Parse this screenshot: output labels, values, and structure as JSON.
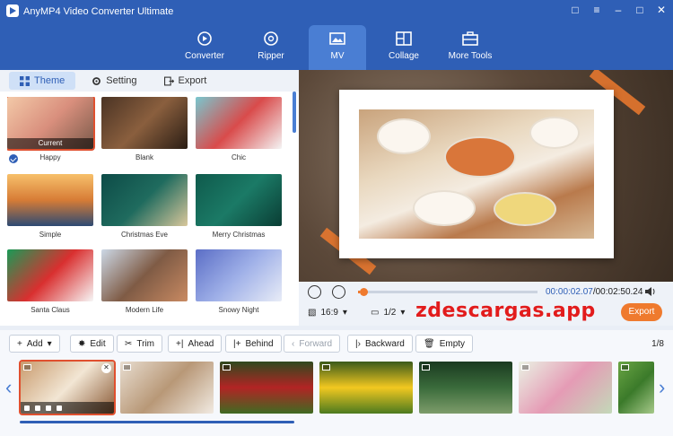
{
  "app": {
    "title": "AnyMP4 Video Converter Ultimate"
  },
  "nav": [
    {
      "label": "Converter",
      "icon": "converter-icon"
    },
    {
      "label": "Ripper",
      "icon": "disc-icon"
    },
    {
      "label": "MV",
      "icon": "mv-icon",
      "active": true
    },
    {
      "label": "Collage",
      "icon": "collage-icon"
    },
    {
      "label": "More Tools",
      "icon": "toolbox-icon"
    }
  ],
  "left_tabs": [
    {
      "label": "Theme",
      "icon": "grid-icon",
      "active": true
    },
    {
      "label": "Setting",
      "icon": "gear-icon"
    },
    {
      "label": "Export",
      "icon": "export-icon"
    }
  ],
  "themes": [
    {
      "name": "Happy",
      "tag": "Current",
      "selected": true,
      "bg": "linear-gradient(135deg,#f3c9a8,#d98f7d,#7a5a4a)"
    },
    {
      "name": "Blank",
      "bg": "linear-gradient(135deg,#4a3324,#8a5f3e,#2a1d14)"
    },
    {
      "name": "Chic",
      "bg": "linear-gradient(135deg,#79c7cf,#d94b4b,#f4f4f4)"
    },
    {
      "name": "Simple",
      "bg": "linear-gradient(180deg,#f7c06b,#d77c36,#2d4a73)"
    },
    {
      "name": "Christmas Eve",
      "bg": "linear-gradient(135deg,#0d4b47,#1f6b5e,#d9c79b)"
    },
    {
      "name": "Merry Christmas",
      "bg": "linear-gradient(135deg,#0f5a4c,#1b7a66,#0a3d34)"
    },
    {
      "name": "Santa Claus",
      "bg": "linear-gradient(135deg,#1a9a56,#d92f2f,#f7f7f7)"
    },
    {
      "name": "Modern Life",
      "bg": "linear-gradient(135deg,#ccd8e6,#7f5b45,#c98a62)"
    },
    {
      "name": "Snowy Night",
      "bg": "linear-gradient(135deg,#5b6ec6,#9fb0e8,#e8ecf7)"
    }
  ],
  "player": {
    "current_time": "00:00:02.07",
    "total_time": "/00:02:50.24",
    "progress": 0.01,
    "ratio": "16:9",
    "page": "1/2",
    "export_label": "Export",
    "watermark": "zdescargas.app"
  },
  "toolbar": {
    "add": "Add",
    "edit": "Edit",
    "trim": "Trim",
    "ahead": "Ahead",
    "behind": "Behind",
    "forward": "Forward",
    "backward": "Backward",
    "empty": "Empty",
    "page_count": "1/8"
  },
  "clips": [
    {
      "name": "dinner-table",
      "selected": true,
      "bg": "linear-gradient(135deg,#c99b6e,#f2e6d4,#8a5a36)"
    },
    {
      "name": "dog",
      "bg": "linear-gradient(135deg,#e8ddd0,#b89877,#f1eae2)"
    },
    {
      "name": "red-tulips",
      "bg": "linear-gradient(180deg,#2f4a1e,#b22424,#3f6b22)"
    },
    {
      "name": "yellow-tulips",
      "bg": "linear-gradient(180deg,#3b5a1a,#f2c820,#4c7a1f)"
    },
    {
      "name": "forest-path",
      "bg": "linear-gradient(180deg,#1b3a20,#3a6b3b,#7d9c6a)"
    },
    {
      "name": "pink-rose",
      "bg": "linear-gradient(135deg,#eaf2e4,#e59bb5,#c3d9b9)"
    },
    {
      "name": "green-field",
      "bg": "linear-gradient(135deg,#6aa544,#3b7a2a,#a6c98a)"
    }
  ]
}
